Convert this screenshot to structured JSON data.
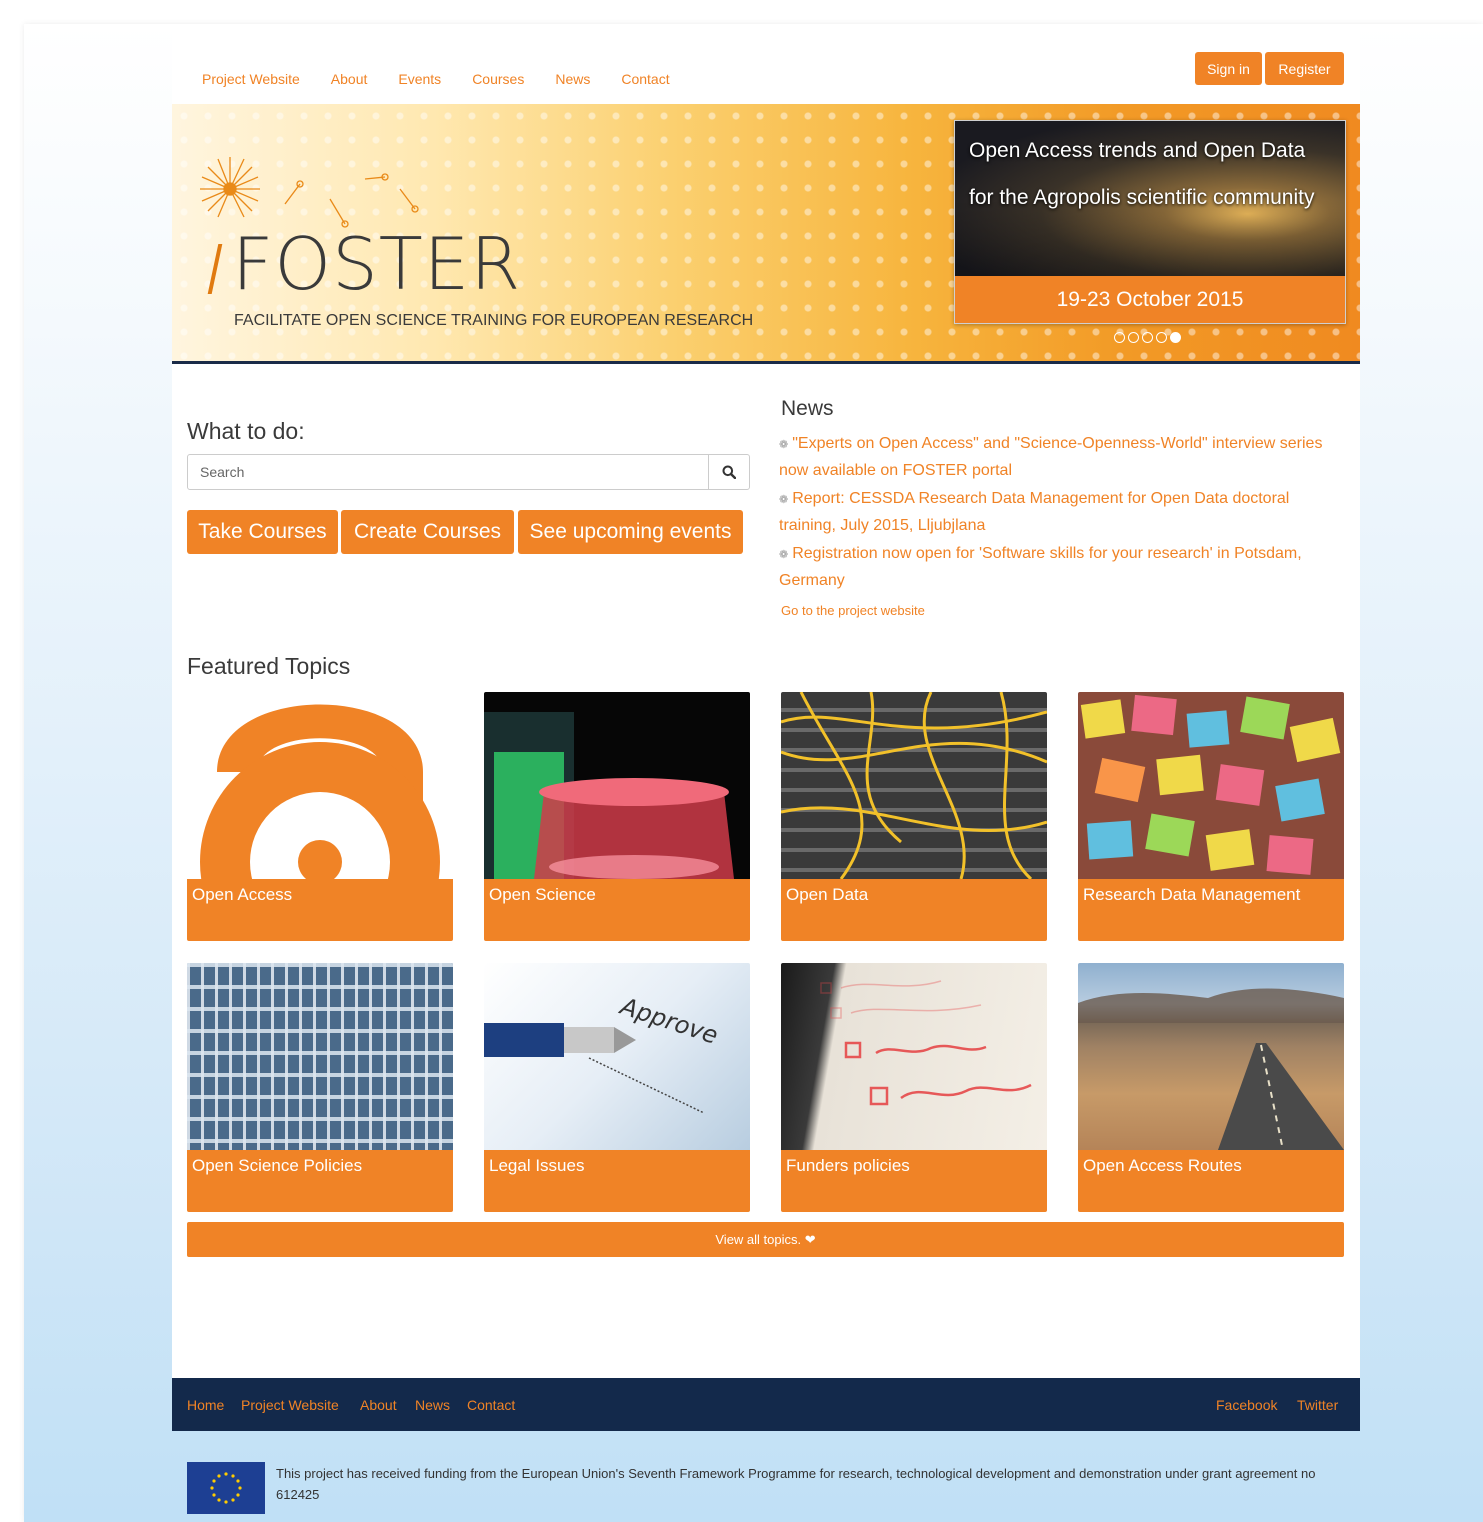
{
  "topnav": {
    "items": [
      "Project Website",
      "About",
      "Events",
      "Courses",
      "News",
      "Contact"
    ]
  },
  "auth": {
    "signin": "Sign in",
    "register": "Register"
  },
  "banner": {
    "logo_text": "FOSTER",
    "tagline": "FACILITATE OPEN SCIENCE TRAINING FOR EUROPEAN RESEARCH",
    "slide_title": "Open Access trends and Open Data for the Agropolis scientific community",
    "slide_date": "19-23 October 2015",
    "slide_count": 5,
    "active_slide": 5
  },
  "what": {
    "title": "What to do:",
    "search_placeholder": "Search",
    "buttons": [
      "Take Courses",
      "Create Courses",
      "See upcoming events"
    ]
  },
  "news": {
    "title": "News",
    "items": [
      "\"Experts on Open Access\" and \"Science-Openness-World\" interview series now available on FOSTER portal",
      "Report: CESSDA Research Data Management for Open Data doctoral training, July 2015, Lljubjlana",
      "Registration now open for 'Software skills for your research' in Potsdam, Germany"
    ],
    "goto": "Go to the project website"
  },
  "featured": {
    "title": "Featured Topics",
    "topics": [
      "Open Access",
      "Open Science",
      "Open Data",
      "Research Data Management",
      "Open Science Policies",
      "Legal Issues",
      "Funders policies",
      "Open Access Routes"
    ],
    "approve_word": "Approve",
    "view_all": "View all topics. ❤"
  },
  "footer": {
    "links": [
      "Home",
      "Project Website",
      "About",
      "News",
      "Contact"
    ],
    "social": [
      "Facebook",
      "Twitter"
    ],
    "funding": "This project has received funding from the European Union's Seventh Framework Programme for research, technological development and demonstration under grant agreement no 612425"
  },
  "colors": {
    "accent": "#f08326",
    "footer": "#13294b",
    "text": "#3a3a3a"
  }
}
